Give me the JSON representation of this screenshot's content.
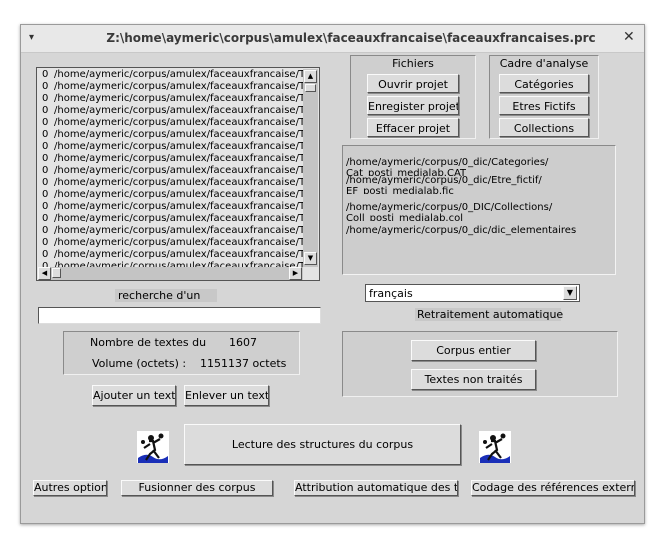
{
  "window": {
    "title": "Z:\\home\\aymeric\\corpus\\amulex\\faceauxfrancaise\\faceauxfrancaises.prc",
    "menu_glyph": "▾",
    "close_glyph": "✕"
  },
  "file_list": {
    "rows": [
      {
        "count": "0",
        "path": "/home/aymeric/corpus/amulex/faceauxfrancaise/T"
      },
      {
        "count": "0",
        "path": "/home/aymeric/corpus/amulex/faceauxfrancaise/T"
      },
      {
        "count": "0",
        "path": "/home/aymeric/corpus/amulex/faceauxfrancaise/T"
      },
      {
        "count": "0",
        "path": "/home/aymeric/corpus/amulex/faceauxfrancaise/T"
      },
      {
        "count": "0",
        "path": "/home/aymeric/corpus/amulex/faceauxfrancaise/T"
      },
      {
        "count": "0",
        "path": "/home/aymeric/corpus/amulex/faceauxfrancaise/T"
      },
      {
        "count": "0",
        "path": "/home/aymeric/corpus/amulex/faceauxfrancaise/T"
      },
      {
        "count": "0",
        "path": "/home/aymeric/corpus/amulex/faceauxfrancaise/T"
      },
      {
        "count": "0",
        "path": "/home/aymeric/corpus/amulex/faceauxfrancaise/T"
      },
      {
        "count": "0",
        "path": "/home/aymeric/corpus/amulex/faceauxfrancaise/T"
      },
      {
        "count": "0",
        "path": "/home/aymeric/corpus/amulex/faceauxfrancaise/T"
      },
      {
        "count": "0",
        "path": "/home/aymeric/corpus/amulex/faceauxfrancaise/T"
      },
      {
        "count": "0",
        "path": "/home/aymeric/corpus/amulex/faceauxfrancaise/T"
      },
      {
        "count": "0",
        "path": "/home/aymeric/corpus/amulex/faceauxfrancaise/T"
      },
      {
        "count": "0",
        "path": "/home/aymeric/corpus/amulex/faceauxfrancaise/T"
      },
      {
        "count": "0",
        "path": "/home/aymeric/corpus/amulex/faceauxfrancaise/T"
      },
      {
        "count": "0",
        "path": "/home/aymeric/corpus/amulex/faceauxfrancaise/T"
      }
    ],
    "scroll_up": "▲",
    "scroll_down": "▼",
    "scroll_left": "◀",
    "scroll_right": "▶"
  },
  "search": {
    "label": "recherche d'un",
    "value": ""
  },
  "stats": {
    "texts_label": "Nombre de textes du",
    "texts_value": "1607",
    "volume_label": "Volume (octets) :",
    "volume_value": "1151137 octets"
  },
  "text_buttons": {
    "add": "Ajouter un texte",
    "remove": "Enlever un texte"
  },
  "fichiers": {
    "title": "Fichiers",
    "open": "Ouvrir projet",
    "save": "Enregister projet",
    "clear": "Effacer projet"
  },
  "cadre": {
    "title": "Cadre d'analyse",
    "categories": "Catégories",
    "etres": "Etres Fictifs",
    "collections": "Collections"
  },
  "paths": {
    "p1a": "/home/aymeric/corpus/0_dic/Categories/",
    "p1b": "Cat_posti_medialab.CAT",
    "p2a": "/home/aymeric/corpus/0_dic/Etre_fictif/",
    "p2b": "EF_posti_medialab.fic",
    "p3a": "/home/aymeric/corpus/0_DIC/Collections/",
    "p3b": "Coll_posti_medialab.col",
    "p4a": "/home/aymeric/corpus/0_dic/dic_elementaires"
  },
  "language": {
    "selected": "français",
    "arrow": "▼"
  },
  "retraitement": {
    "label": "Retraitement automatique",
    "corpus_entier": "Corpus entier",
    "non_traites": "Textes non traités"
  },
  "main_action": {
    "label": "Lecture des structures du corpus"
  },
  "bottom_bar": {
    "options": "Autres options",
    "fusion": "Fusionner des corpus",
    "titres": "Attribution automatique des titres",
    "codage": "Codage des références externes"
  }
}
